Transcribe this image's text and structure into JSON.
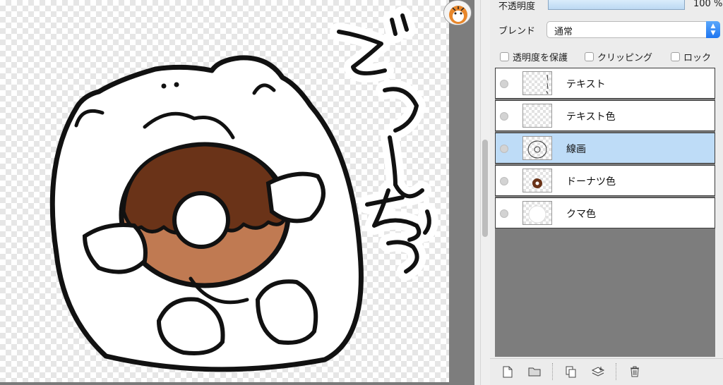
{
  "properties": {
    "opacity_label": "不透明度",
    "opacity_value": "100 %",
    "opacity_percent": 100,
    "blend_label": "ブレンド",
    "blend_value": "通常",
    "checks": [
      {
        "label": "透明度を保護",
        "checked": false
      },
      {
        "label": "クリッピング",
        "checked": false
      },
      {
        "label": "ロック",
        "checked": false
      }
    ]
  },
  "layers": [
    {
      "name": "テキスト",
      "selected": false,
      "thumb": "text-lines"
    },
    {
      "name": "テキスト色",
      "selected": false,
      "thumb": "empty"
    },
    {
      "name": "線画",
      "selected": true,
      "thumb": "lineart"
    },
    {
      "name": "ドーナツ色",
      "selected": false,
      "thumb": "donut"
    },
    {
      "name": "クマ色",
      "selected": false,
      "thumb": "bear"
    }
  ],
  "canvas": {
    "text": "どうしなっつ"
  },
  "colors": {
    "selection": "#bedcf7",
    "donut_chocolate": "#6a3318",
    "donut_dough": "#c07a52",
    "accent_blue": "#1f76f0"
  },
  "toolbar": {
    "icons": [
      "new-layer-icon",
      "new-folder-icon",
      "duplicate-layer-icon",
      "merge-down-icon",
      "delete-layer-icon"
    ]
  }
}
